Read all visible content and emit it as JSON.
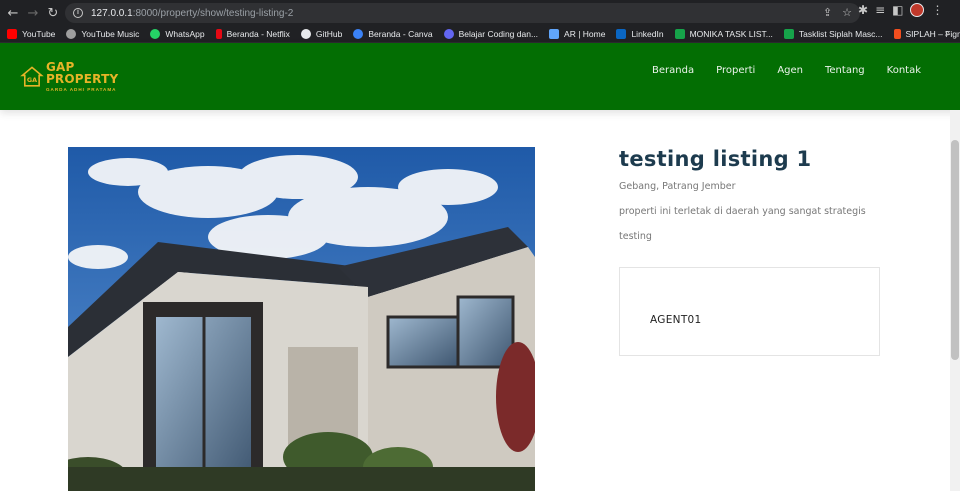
{
  "browser": {
    "url_host": "127.0.0.1",
    "url_rest": ":8000/property/show/testing-listing-2",
    "bookmarks": [
      {
        "label": "YouTube",
        "color": "#ff0000"
      },
      {
        "label": "YouTube Music",
        "color": "#e8eaed"
      },
      {
        "label": "WhatsApp",
        "color": "#25d366"
      },
      {
        "label": "Beranda - Netflix",
        "color": "#e50914"
      },
      {
        "label": "GitHub",
        "color": "#e8eaed"
      },
      {
        "label": "Beranda - Canva",
        "color": "#3b82f6"
      },
      {
        "label": "Belajar Coding dan...",
        "color": "#6366f1"
      },
      {
        "label": "AR | Home",
        "color": "#60a5fa"
      },
      {
        "label": "LinkedIn",
        "color": "#0a66c2"
      },
      {
        "label": "MONIKA TASK LIST...",
        "color": "#16a34a"
      },
      {
        "label": "Tasklist Siplah Masc...",
        "color": "#16a34a"
      },
      {
        "label": "SIPLAH – Figma",
        "color": "#f24e1e"
      }
    ],
    "more_label": "»"
  },
  "site": {
    "logo_title": "GAP PROPERTY",
    "logo_subtitle": "GARDA ADHI PRATAMA",
    "brand_color": "#036e03",
    "nav": [
      "Beranda",
      "Properti",
      "Agen",
      "Tentang",
      "Kontak"
    ]
  },
  "property": {
    "title": "testing listing 1",
    "location": "Gebang, Patrang Jember",
    "description": "properti ini terletak di daerah yang sangat strategis",
    "extra": "testing",
    "agent": "AGENT01"
  }
}
